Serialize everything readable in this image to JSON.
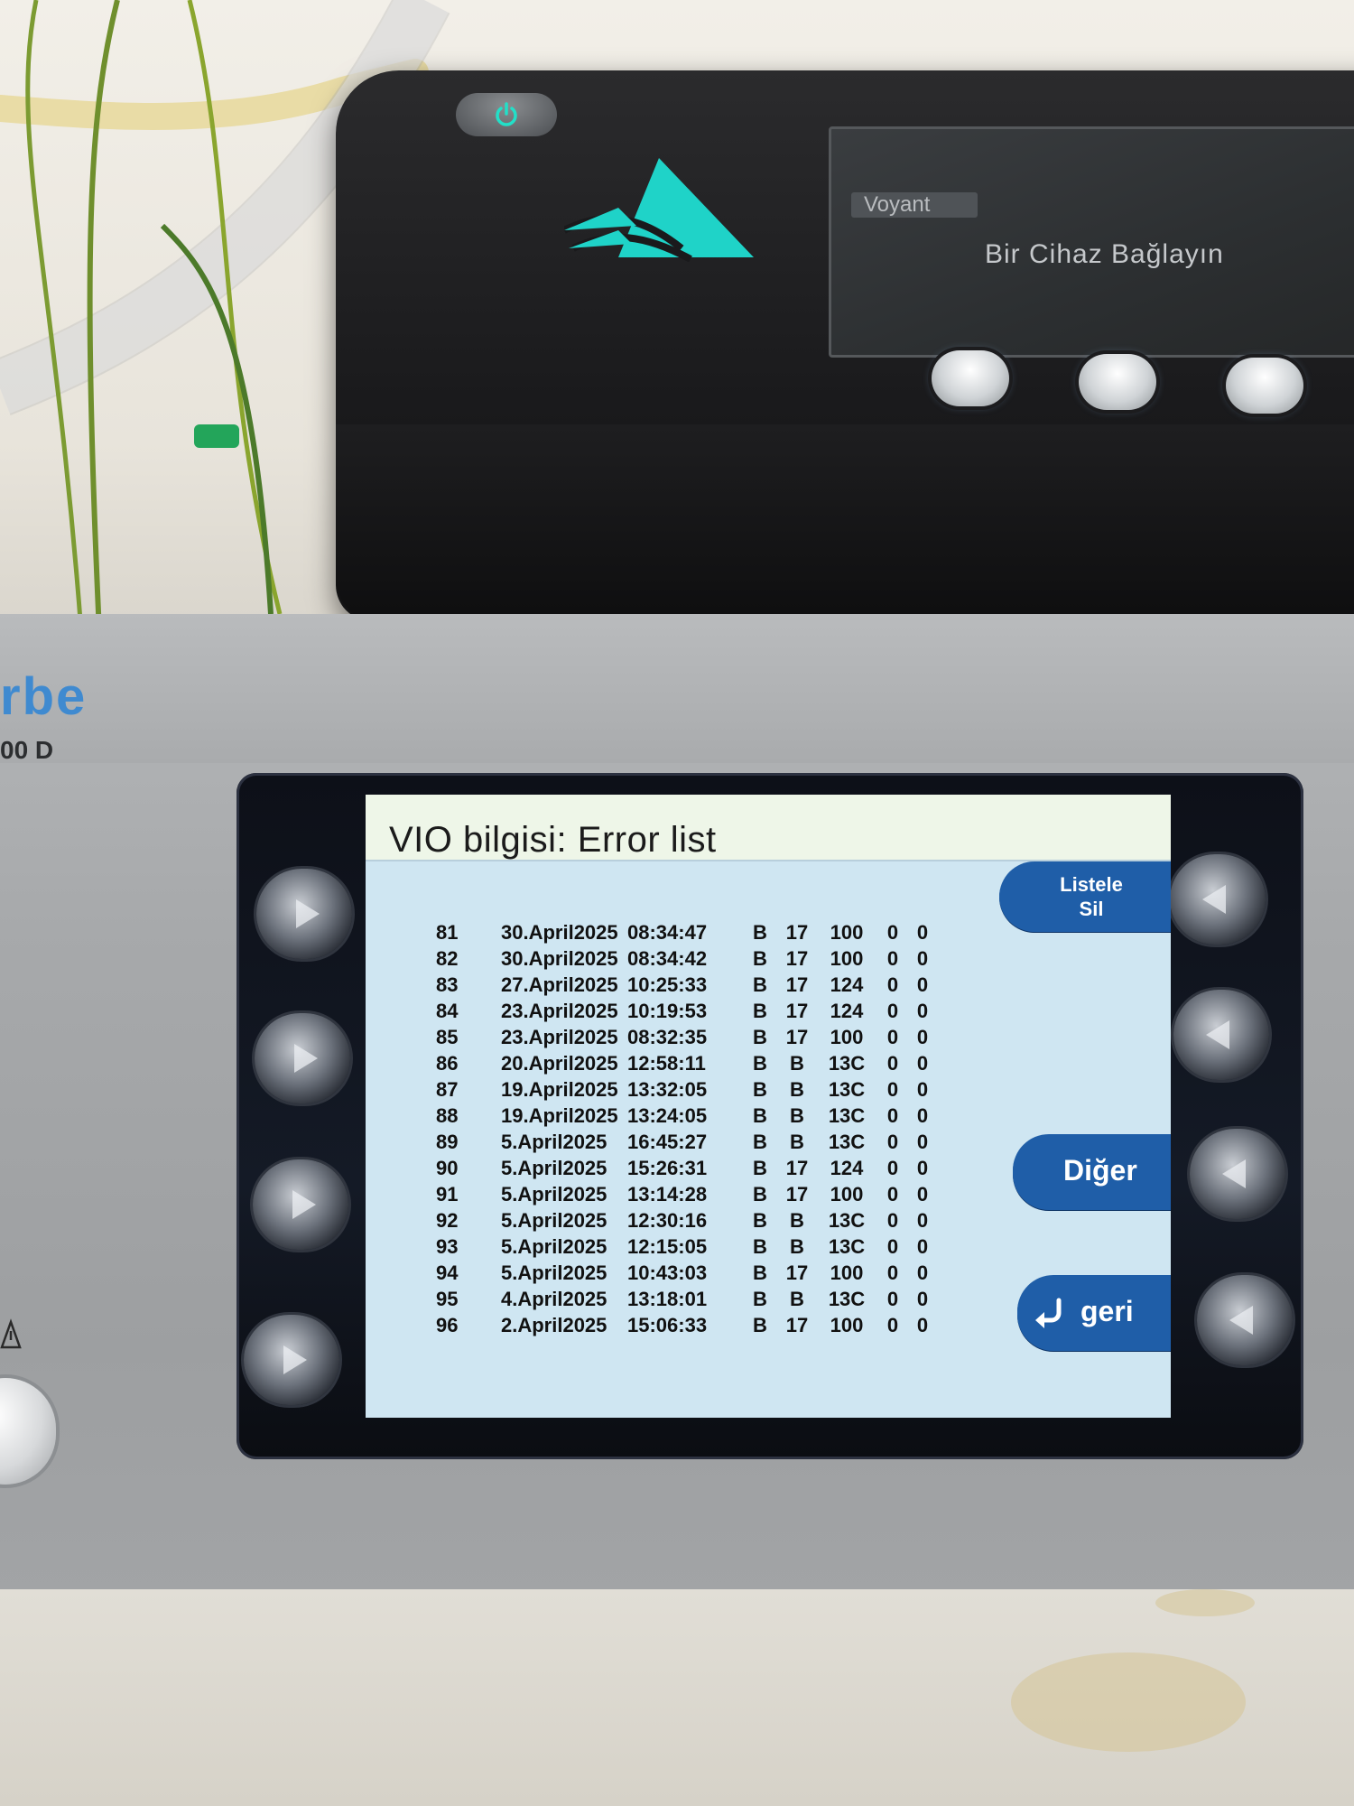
{
  "top_device": {
    "screen_tab": "Voyant",
    "screen_message": "Bir Cihaz Bağlayın",
    "accent_color": "#1fd3c8"
  },
  "erbe_device": {
    "brand_partial": "rbe",
    "model_partial": "00 D"
  },
  "lcd": {
    "title": "VIO bilgisi: Error list",
    "buttons": {
      "list_delete_line1": "Listele",
      "list_delete_line2": "Sil",
      "other": "Diğer",
      "back": "geri"
    },
    "rows": [
      {
        "no": "81",
        "date": "30.April2025",
        "time": "08:34:47",
        "a": "B",
        "b": "17",
        "c": "100",
        "d": "0",
        "e": "0"
      },
      {
        "no": "82",
        "date": "30.April2025",
        "time": "08:34:42",
        "a": "B",
        "b": "17",
        "c": "100",
        "d": "0",
        "e": "0"
      },
      {
        "no": "83",
        "date": "27.April2025",
        "time": "10:25:33",
        "a": "B",
        "b": "17",
        "c": "124",
        "d": "0",
        "e": "0"
      },
      {
        "no": "84",
        "date": "23.April2025",
        "time": "10:19:53",
        "a": "B",
        "b": "17",
        "c": "124",
        "d": "0",
        "e": "0"
      },
      {
        "no": "85",
        "date": "23.April2025",
        "time": "08:32:35",
        "a": "B",
        "b": "17",
        "c": "100",
        "d": "0",
        "e": "0"
      },
      {
        "no": "86",
        "date": "20.April2025",
        "time": "12:58:11",
        "a": "B",
        "b": "B",
        "c": "13C",
        "d": "0",
        "e": "0"
      },
      {
        "no": "87",
        "date": "19.April2025",
        "time": "13:32:05",
        "a": "B",
        "b": "B",
        "c": "13C",
        "d": "0",
        "e": "0"
      },
      {
        "no": "88",
        "date": "19.April2025",
        "time": "13:24:05",
        "a": "B",
        "b": "B",
        "c": "13C",
        "d": "0",
        "e": "0"
      },
      {
        "no": "89",
        "date": "5.April2025",
        "time": "16:45:27",
        "a": "B",
        "b": "B",
        "c": "13C",
        "d": "0",
        "e": "0"
      },
      {
        "no": "90",
        "date": "5.April2025",
        "time": "15:26:31",
        "a": "B",
        "b": "17",
        "c": "124",
        "d": "0",
        "e": "0"
      },
      {
        "no": "91",
        "date": "5.April2025",
        "time": "13:14:28",
        "a": "B",
        "b": "17",
        "c": "100",
        "d": "0",
        "e": "0"
      },
      {
        "no": "92",
        "date": "5.April2025",
        "time": "12:30:16",
        "a": "B",
        "b": "B",
        "c": "13C",
        "d": "0",
        "e": "0"
      },
      {
        "no": "93",
        "date": "5.April2025",
        "time": "12:15:05",
        "a": "B",
        "b": "B",
        "c": "13C",
        "d": "0",
        "e": "0"
      },
      {
        "no": "94",
        "date": "5.April2025",
        "time": "10:43:03",
        "a": "B",
        "b": "17",
        "c": "100",
        "d": "0",
        "e": "0"
      },
      {
        "no": "95",
        "date": "4.April2025",
        "time": "13:18:01",
        "a": "B",
        "b": "B",
        "c": "13C",
        "d": "0",
        "e": "0"
      },
      {
        "no": "96",
        "date": "2.April2025",
        "time": "15:06:33",
        "a": "B",
        "b": "17",
        "c": "100",
        "d": "0",
        "e": "0"
      }
    ]
  },
  "icons": {
    "power": "power-icon",
    "logo": "voyant-logo",
    "back": "back-arrow-icon",
    "softkey_arrow": "play-arrow-icon",
    "warning": "warning-icon"
  }
}
